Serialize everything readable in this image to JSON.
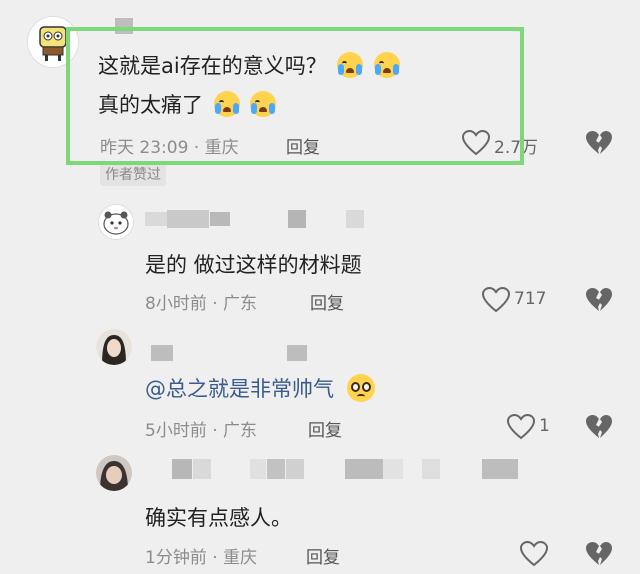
{
  "comments": [
    {
      "text_line1": "这就是ai存在的意义吗？",
      "text_line2": "真的太痛了",
      "time": "昨天 23:09 · 重庆",
      "reply": "回复",
      "likes": "2.7万",
      "tag": "作者赞过",
      "emoji": "crying-face"
    },
    {
      "text": "是的 做过这样的材料题",
      "time": "8小时前 · 广东",
      "reply": "回复",
      "likes": "717"
    },
    {
      "text": "@总之就是非常帅气",
      "time": "5小时前 · 广东",
      "reply": "回复",
      "likes": "1",
      "emoji": "pleading-face"
    },
    {
      "text": "确实有点感人。",
      "time": "1分钟前 · 重庆",
      "reply": "回复",
      "likes": ""
    }
  ],
  "colors": {
    "highlight_border": "#7dd87a",
    "background": "#efefef"
  },
  "icons": {
    "like": "heart-outline-icon",
    "dislike": "broken-heart-icon"
  }
}
